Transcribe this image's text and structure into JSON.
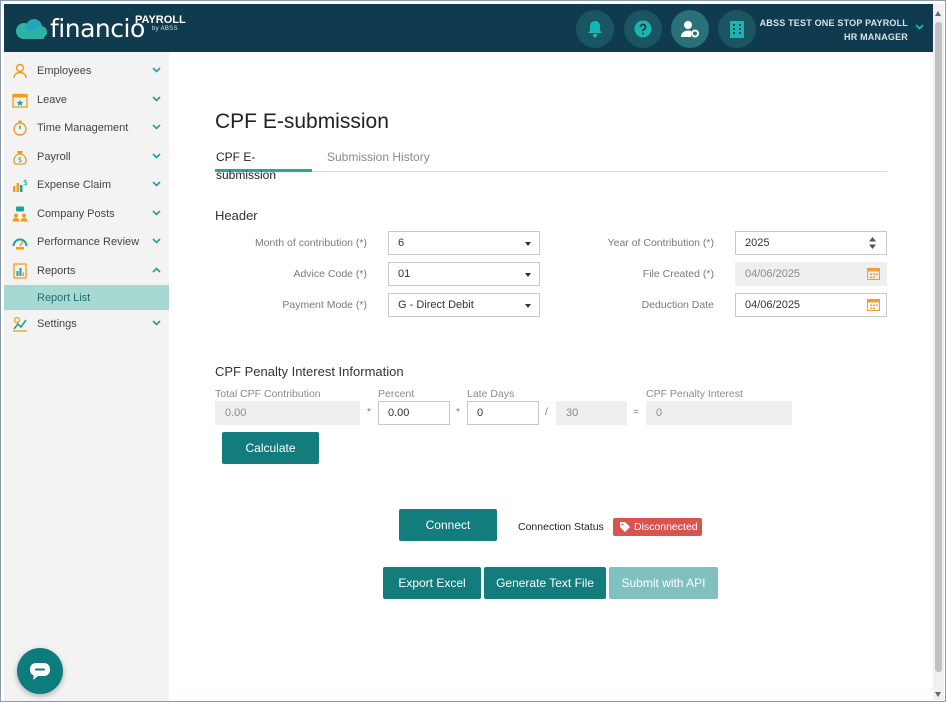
{
  "app": {
    "brand_word": "financio",
    "product_tag": "PAYROLL",
    "byline": "by ABSS",
    "company_name": "ABSS TEST ONE STOP PAYROLL",
    "user_role": "HR MANAGER",
    "brand_color": "#103b4f",
    "accent_color": "#137c7c"
  },
  "topbar": {
    "icons": [
      "bell-icon",
      "help-icon",
      "user-settings-icon",
      "building-icon"
    ]
  },
  "sidebar": {
    "items": [
      {
        "label": "Employees",
        "icon": "user-icon"
      },
      {
        "label": "Leave",
        "icon": "calendar-star-icon"
      },
      {
        "label": "Time Management",
        "icon": "stopwatch-icon"
      },
      {
        "label": "Payroll",
        "icon": "money-bag-icon"
      },
      {
        "label": "Expense Claim",
        "icon": "chart-dollar-icon"
      },
      {
        "label": "Company Posts",
        "icon": "people-chat-icon"
      },
      {
        "label": "Performance Review",
        "icon": "gauge-icon"
      },
      {
        "label": "Reports",
        "icon": "report-icon"
      },
      {
        "label": "Settings",
        "icon": "settings-chart-icon"
      }
    ],
    "reports_sub": "Report List"
  },
  "page": {
    "title": "CPF E-submission",
    "tabs": [
      {
        "label": "CPF E-submission",
        "active": true
      },
      {
        "label": "Submission History",
        "active": false
      }
    ]
  },
  "header_section": {
    "title": "Header",
    "month_label": "Month of contribution (*)",
    "month_value": "6",
    "advice_label": "Advice Code (*)",
    "advice_value": "01",
    "payment_label": "Payment Mode (*)",
    "payment_value": "G - Direct Debit",
    "year_label": "Year of Contribution (*)",
    "year_value": "2025",
    "file_created_label": "File Created (*)",
    "file_created_value": "04/06/2025",
    "deduction_label": "Deduction Date",
    "deduction_value": "04/06/2025"
  },
  "penalty": {
    "title": "CPF Penalty Interest Information",
    "total_label": "Total CPF Contribution",
    "total_value": "0.00",
    "percent_label": "Percent",
    "percent_value": "0.00",
    "late_label": "Late Days",
    "late_value": "0",
    "divisor_value": "30",
    "interest_label": "CPF Penalty Interest",
    "interest_value": "0",
    "op_multiply": "*",
    "op_divide": "/",
    "op_equals": "=",
    "calculate_label": "Calculate"
  },
  "connection": {
    "connect_label": "Connect",
    "status_label": "Connection Status",
    "status_value": "Disconnected",
    "status_color": "#d9534f"
  },
  "actions": {
    "export_excel": "Export Excel",
    "generate_text": "Generate Text File",
    "submit_api": "Submit with API"
  }
}
